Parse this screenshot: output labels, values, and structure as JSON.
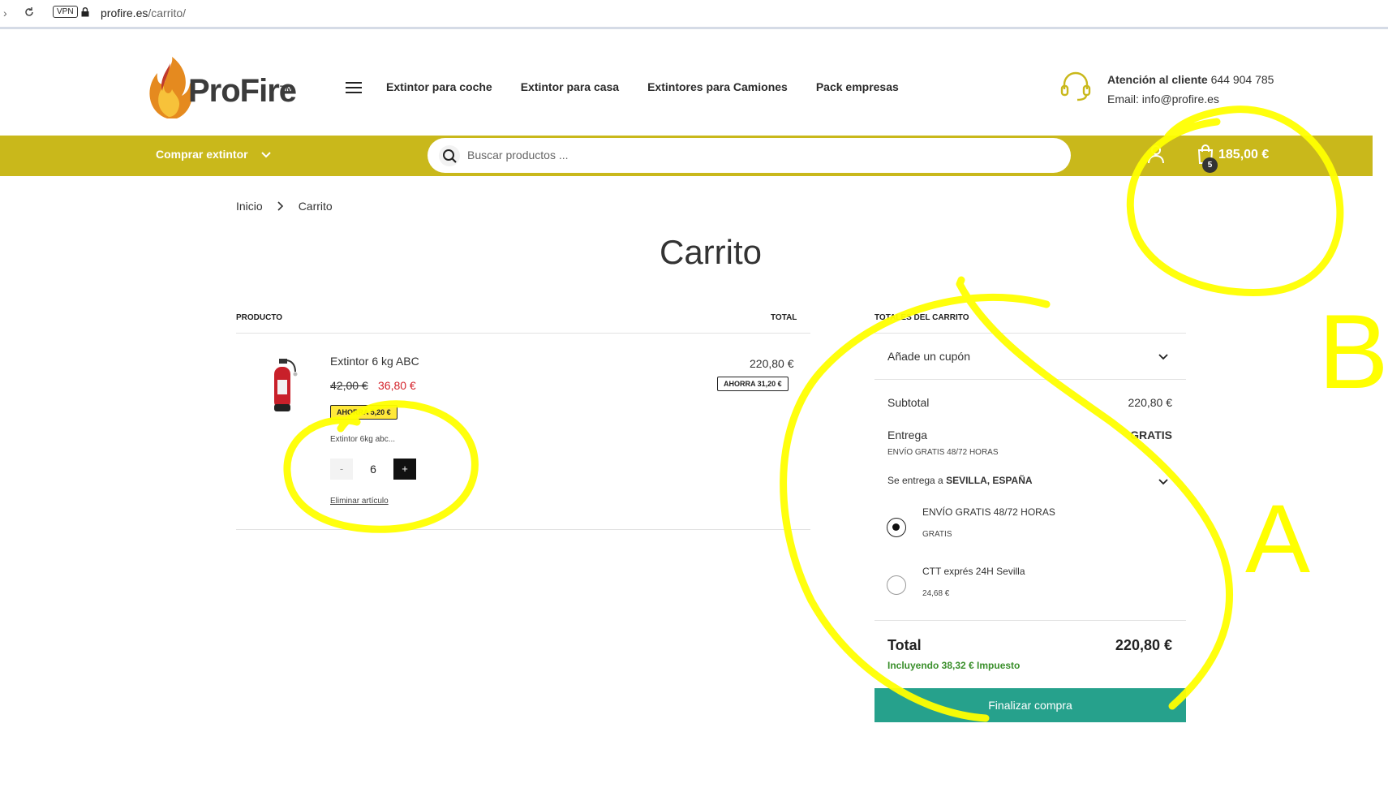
{
  "browser": {
    "vpn_label": "VPN",
    "url_host": "profire.es",
    "url_path": "/carrito/"
  },
  "header": {
    "logo_text": "ProFire",
    "logo_tm": "TM",
    "nav": [
      "Extintor para coche",
      "Extintor para casa",
      "Extintores para Camiones",
      "Pack empresas"
    ],
    "contact_label": "Atención al cliente",
    "contact_phone": "644 904 785",
    "contact_email": "Email: info@profire.es"
  },
  "toolbar": {
    "buy_menu": "Comprar extintor",
    "search_placeholder": "Buscar productos ...",
    "cart_count": "5",
    "cart_total": "185,00 €"
  },
  "breadcrumb": {
    "home": "Inicio",
    "current": "Carrito"
  },
  "page": {
    "title": "Carrito"
  },
  "cart_table": {
    "col_product": "PRODUCTO",
    "col_total": "TOTAL",
    "items": [
      {
        "name": "Extintor 6 kg ABC",
        "price_old": "42,00 €",
        "price_new": "36,80 €",
        "save_badge": "AHORRA 5,20 €",
        "description": "Extintor 6kg abc...",
        "qty_minus": "-",
        "quantity": "6",
        "qty_plus": "+",
        "remove": "Eliminar artículo",
        "line_total": "220,80 €",
        "line_save": "AHORRA 31,20 €"
      }
    ]
  },
  "totals": {
    "title": "TOTALES DEL CARRITO",
    "coupon": "Añade un cupón",
    "subtotal_label": "Subtotal",
    "subtotal_value": "220,80 €",
    "shipping_label": "Entrega",
    "shipping_value": "GRATIS",
    "shipping_method": "ENVÍO GRATIS 48/72 HORAS",
    "ship_to_prefix": "Se entrega a",
    "ship_to_place": "SEVILLA, ESPAÑA",
    "options": [
      {
        "label": "ENVÍO GRATIS 48/72 HORAS",
        "price": "GRATIS",
        "checked": true
      },
      {
        "label": "CTT exprés 24H Sevilla",
        "price": "24,68 €",
        "checked": false
      }
    ],
    "total_label": "Total",
    "total_value": "220,80 €",
    "tax_note": "Incluyendo 38,32 € Impuesto",
    "checkout": "Finalizar compra"
  },
  "annotations": {
    "letter_a": "A",
    "letter_b": "B",
    "color": "#ffff00"
  },
  "colors": {
    "brand_bar": "#c9b81b",
    "checkout": "#26a18c",
    "sale_price": "#d4232b",
    "tax_note": "#3a8f2b"
  }
}
